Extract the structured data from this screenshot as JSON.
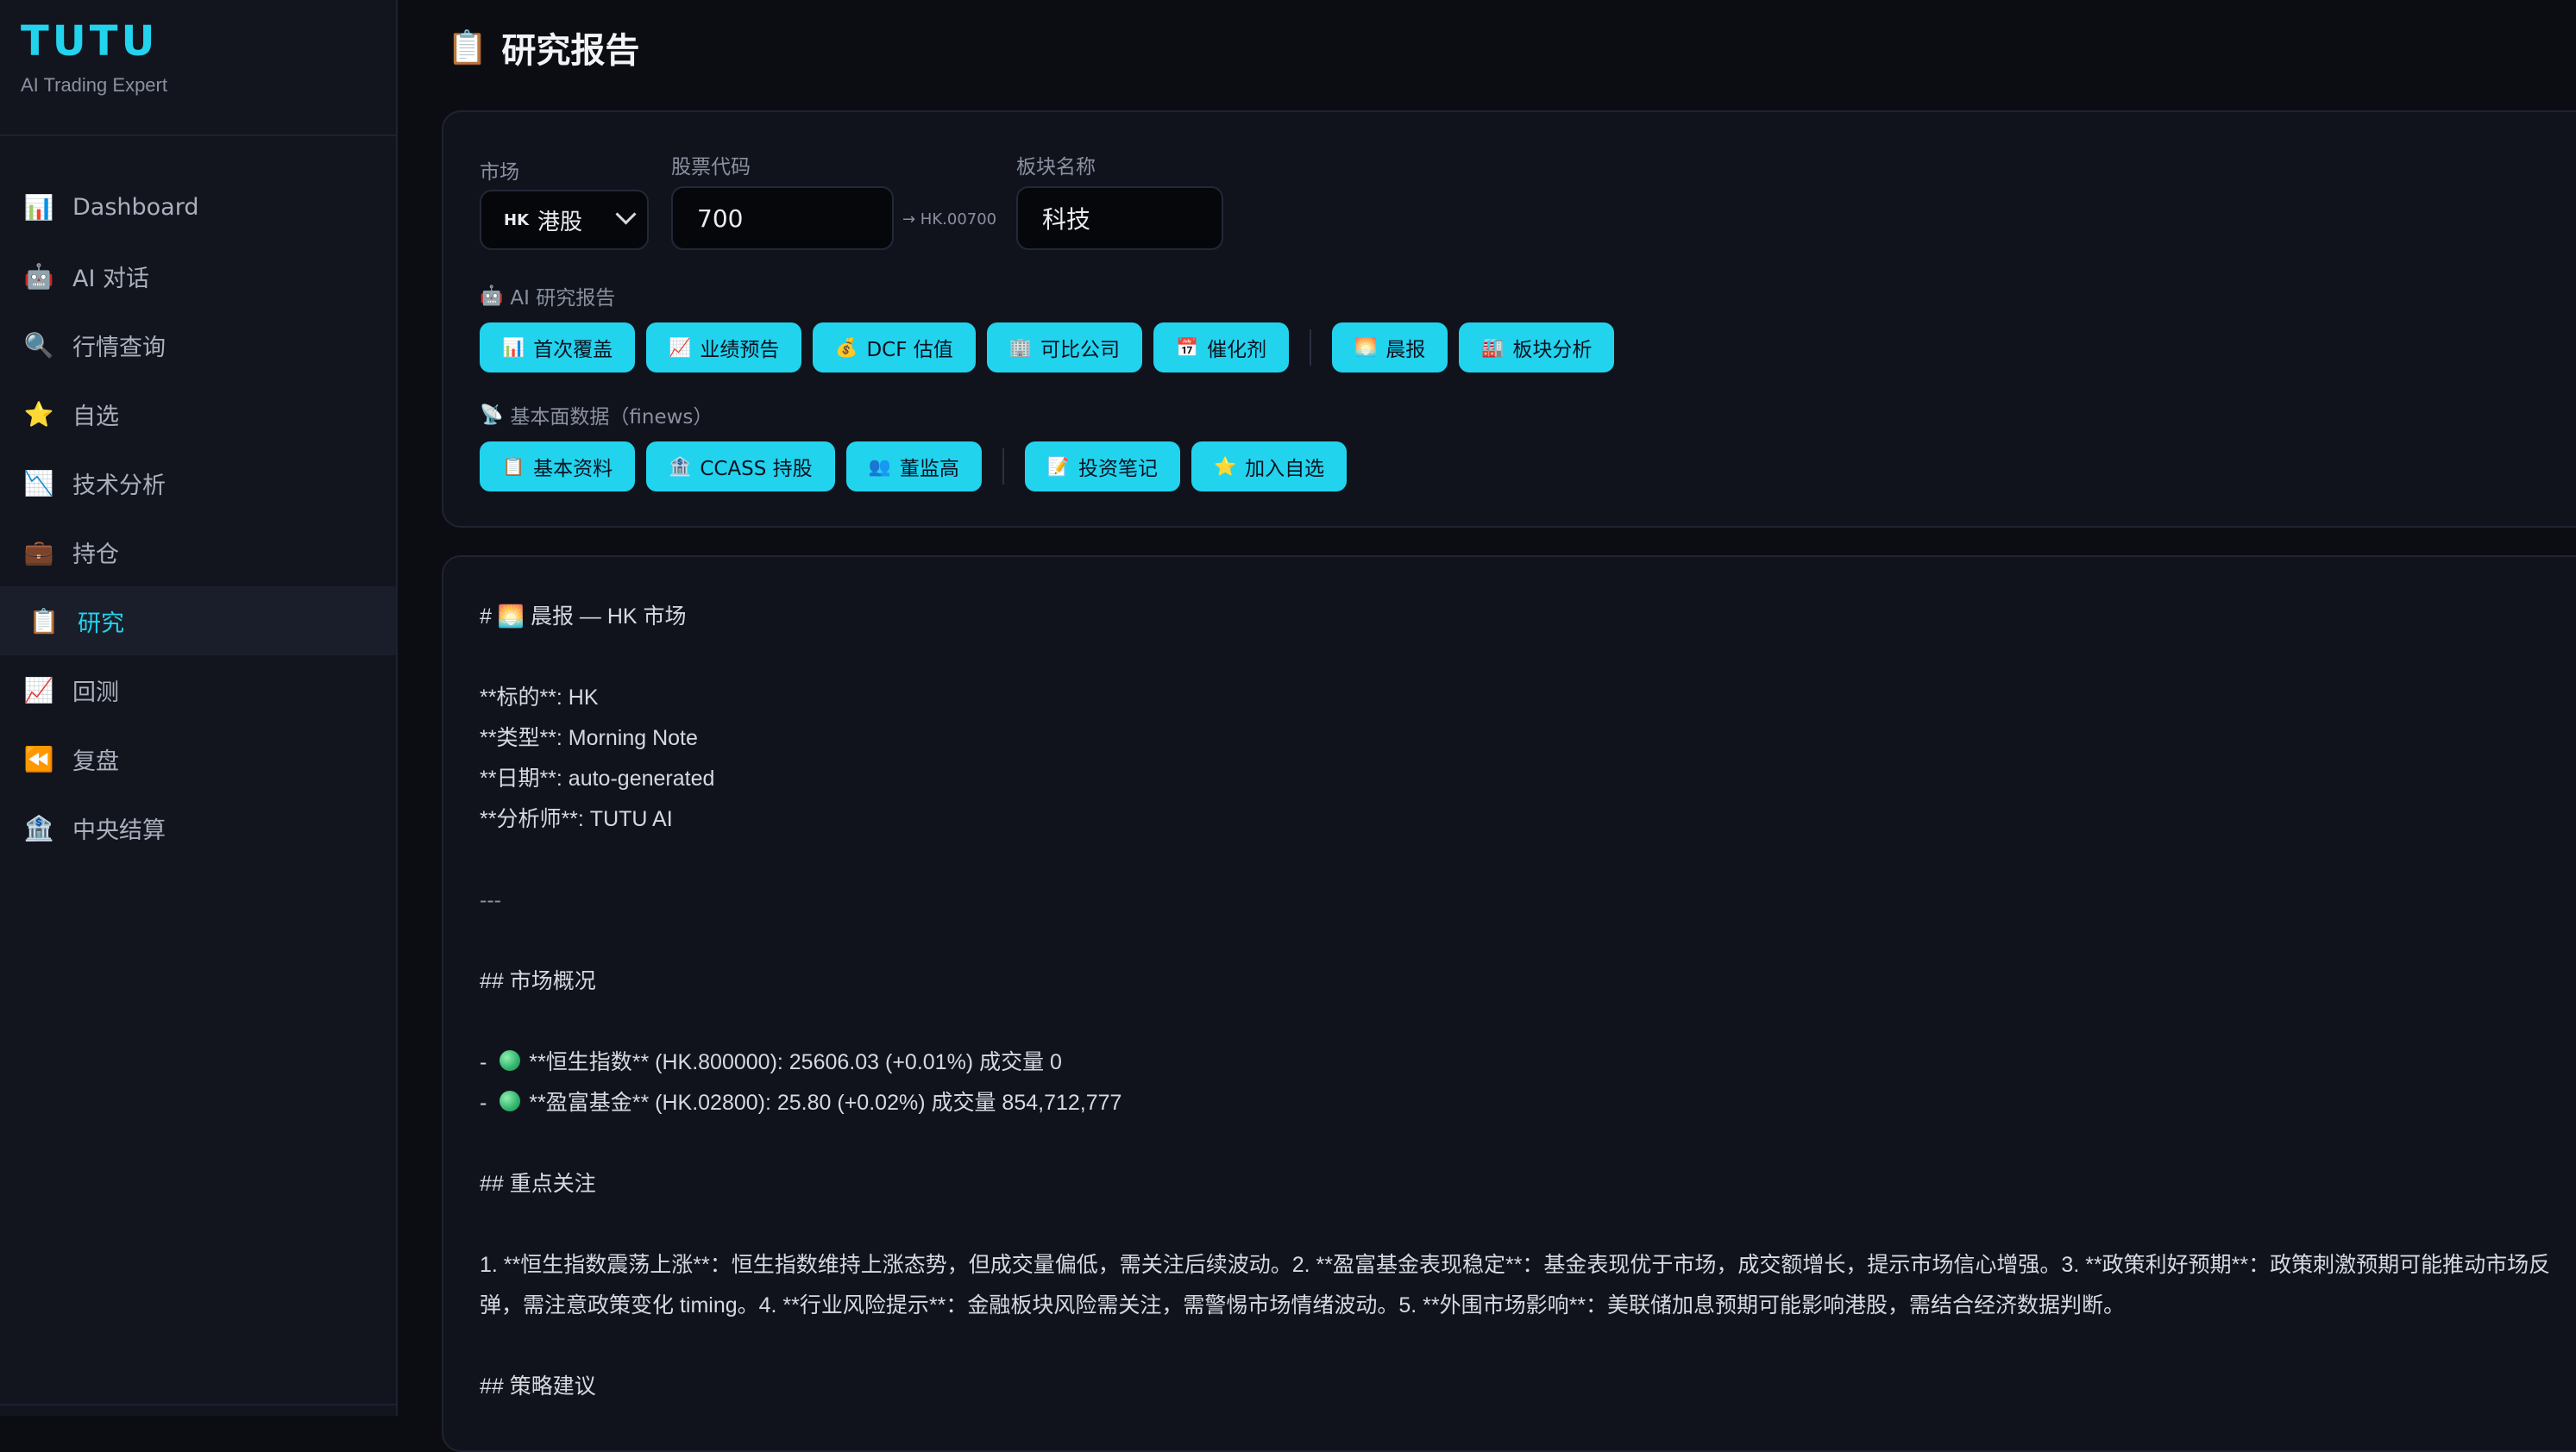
{
  "brand": {
    "title": "TUTU",
    "subtitle": "AI Trading Expert"
  },
  "sidebar": {
    "items": [
      {
        "icon": "bar-chart-icon",
        "glyph": "📊",
        "label": "Dashboard"
      },
      {
        "icon": "robot-icon",
        "glyph": "🤖",
        "label": "AI 对话"
      },
      {
        "icon": "magnifier-icon",
        "glyph": "🔍",
        "label": "行情查询"
      },
      {
        "icon": "star-icon",
        "glyph": "⭐",
        "label": "自选"
      },
      {
        "icon": "chart-down-icon",
        "glyph": "📉",
        "label": "技术分析"
      },
      {
        "icon": "briefcase-icon",
        "glyph": "💼",
        "label": "持仓"
      },
      {
        "icon": "clipboard-icon",
        "glyph": "📋",
        "label": "研究",
        "active": true
      },
      {
        "icon": "chart-up-icon",
        "glyph": "📈",
        "label": "回测"
      },
      {
        "icon": "rewind-icon",
        "glyph": "⏪",
        "label": "复盘"
      },
      {
        "icon": "bank-icon",
        "glyph": "🏦",
        "label": "中央结算"
      }
    ]
  },
  "header": {
    "icon": "clipboard-icon",
    "glyph": "📋",
    "title": "研究报告"
  },
  "controls": {
    "market_label": "市场",
    "market_value": "港股",
    "market_prefix": "HK",
    "code_label": "股票代码",
    "code_value": "700",
    "code_hint": "→ HK.00700",
    "sector_label": "板块名称",
    "sector_value": "科技",
    "ai_section_label": "AI 研究报告",
    "ai_section_icon": "🤖",
    "fund_section_label": "基本面数据（finews）",
    "fund_section_icon": "📡",
    "ai_buttons": [
      {
        "icon": "bar-chart-icon",
        "glyph": "📊",
        "label": "首次覆盖"
      },
      {
        "icon": "chart-up-icon",
        "glyph": "📈",
        "label": "业绩预告"
      },
      {
        "icon": "money-bag-icon",
        "glyph": "💰",
        "label": "DCF 估值"
      },
      {
        "icon": "building-icon",
        "glyph": "🏢",
        "label": "可比公司"
      },
      {
        "icon": "calendar-icon",
        "glyph": "📅",
        "label": "催化剂"
      }
    ],
    "ai_buttons_2": [
      {
        "icon": "sunrise-icon",
        "glyph": "🌅",
        "label": "晨报"
      },
      {
        "icon": "factory-icon",
        "glyph": "🏭",
        "label": "板块分析"
      }
    ],
    "fund_buttons": [
      {
        "icon": "document-icon",
        "glyph": "📋",
        "label": "基本资料"
      },
      {
        "icon": "bank-icon",
        "glyph": "🏦",
        "label": "CCASS 持股"
      },
      {
        "icon": "people-icon",
        "glyph": "👥",
        "label": "董监高"
      }
    ],
    "fund_buttons_2": [
      {
        "icon": "memo-icon",
        "glyph": "📝",
        "label": "投资笔记"
      },
      {
        "icon": "star-icon",
        "glyph": "⭐",
        "label": "加入自选"
      }
    ]
  },
  "report": {
    "heading_prefix": "#",
    "heading_glyph": "🌅",
    "heading_text": "晨报 — HK 市场",
    "meta": [
      "**标的**: HK",
      "**类型**: Morning Note",
      "**日期**: auto-generated",
      "**分析师**: TUTU AI"
    ],
    "separator": "---",
    "section1": "## 市场概况",
    "bullets": [
      "**恒生指数** (HK.800000): 25606.03 (+0.01%) 成交量 0",
      "**盈富基金** (HK.02800): 25.80 (+0.02%) 成交量 854,712,777"
    ],
    "section2": "## 重点关注",
    "focus": "1. **恒生指数震荡上涨**：恒生指数维持上涨态势，但成交量偏低，需关注后续波动。2. **盈富基金表现稳定**：基金表现优于市场，成交额增长，提示市场信心增强。3. **政策利好预期**：政策刺激预期可能推动市场反弹，需注意政策变化 timing。4. **行业风险提示**：金融板块风险需关注，需警惕市场情绪波动。5. **外围市场影响**：美联储加息预期可能影响港股，需结合经济数据判断。",
    "section3": "## 策略建议"
  },
  "colors": {
    "accent": "#22d3ee",
    "background": "#0b0d13",
    "sidebar": "#12151e",
    "card": "#10131b"
  }
}
